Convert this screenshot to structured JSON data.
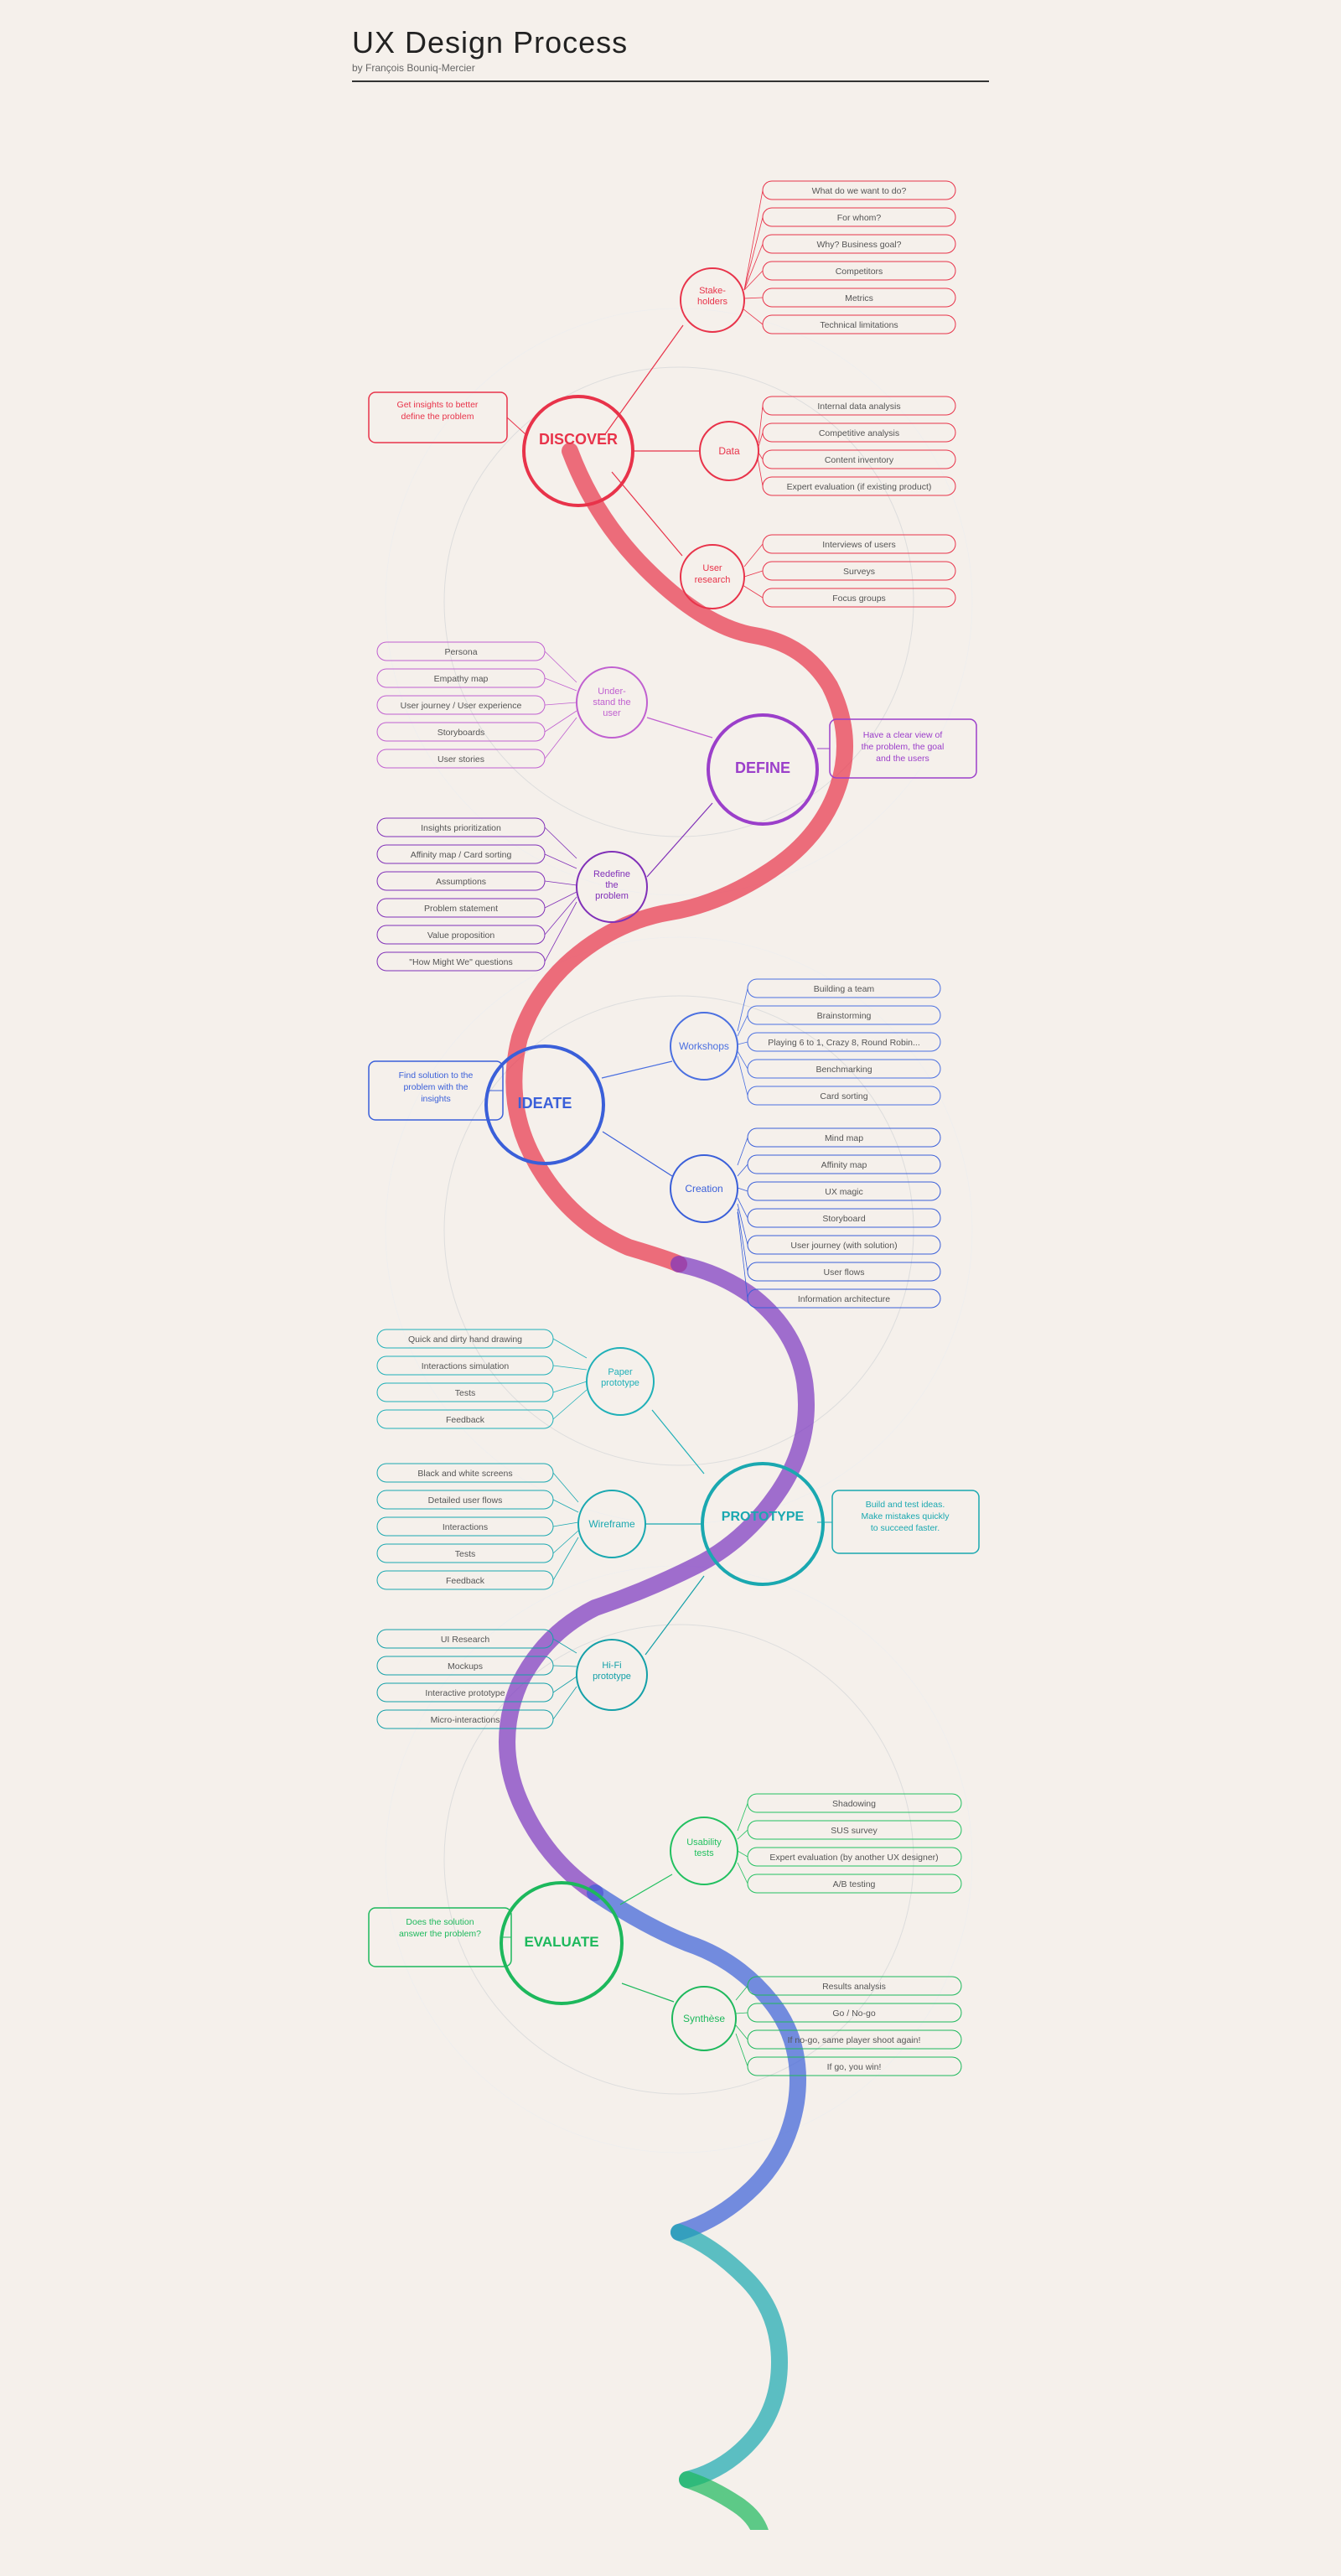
{
  "title": "UX Design Process",
  "subtitle": "by François Bouniq-Mercier",
  "phases": [
    {
      "id": "discover",
      "label": "DISCOVER",
      "color": "#e8334a",
      "note": "Get insights to better\ndefine the problem",
      "sub_nodes": [
        {
          "label": "Stake-\nholders",
          "items": [
            "What do we want to do?",
            "For whom?",
            "Why? Business goal?",
            "Competitors",
            "Metrics",
            "Technical limitations"
          ]
        },
        {
          "label": "Data",
          "items": [
            "Internal data analysis",
            "Competitive analysis",
            "Content inventory",
            "Expert evaluation (if existing product)"
          ]
        },
        {
          "label": "User\nresearch",
          "items": [
            "Interviews of users",
            "Surveys",
            "Focus groups"
          ]
        }
      ]
    },
    {
      "id": "define",
      "label": "DEFINE",
      "color": "#9b3fca",
      "note": "Have a clear view of\nthe problem, the goal\nand the users",
      "sub_nodes": [
        {
          "label": "Under-\nstand the\nuser",
          "items": [
            "Persona",
            "Empathy map",
            "User journey / User experience",
            "Storyboards",
            "User stories"
          ]
        },
        {
          "label": "Redefine\nthe\nproblem",
          "items": [
            "Insights prioritization",
            "Affinity map / Card sorting",
            "Assumptions",
            "Problem statement",
            "Value proposition",
            "\"How Might We\" questions"
          ]
        }
      ]
    },
    {
      "id": "ideate",
      "label": "IDEATE",
      "color": "#3a5fd9",
      "note": "Find solution to the\nproblem with the\ninsights",
      "sub_nodes": [
        {
          "label": "Workshops",
          "items": [
            "Building a team",
            "Brainstorming",
            "Playing 6 to 1, Crazy 8, Round Robin...",
            "Benchmarking",
            "Card sorting"
          ]
        },
        {
          "label": "Creation",
          "items": [
            "Mind map",
            "Affinity map",
            "UX magic",
            "Storyboard",
            "User journey (with solution)",
            "User flows",
            "Information architecture"
          ]
        }
      ]
    },
    {
      "id": "prototype",
      "label": "PROTOTYPE",
      "color": "#1aa8b0",
      "note": "Build and test ideas.\nMake mistakes quickly\nto succeed faster.",
      "sub_nodes": [
        {
          "label": "Paper\nprototype",
          "items": [
            "Quick and dirty hand drawing",
            "Interactions simulation",
            "Tests",
            "Feedback"
          ]
        },
        {
          "label": "Wireframe",
          "items": [
            "Black and white screens",
            "Detailed user flows",
            "Interactions",
            "Tests",
            "Feedback"
          ]
        },
        {
          "label": "Hi-Fi\nprototype",
          "items": [
            "UI Research",
            "Mockups",
            "Interactive prototype",
            "Micro-interactions"
          ]
        }
      ]
    },
    {
      "id": "evaluate",
      "label": "EVALUATE",
      "color": "#1db85c",
      "note": "Does the solution\nanswer the problem?",
      "sub_nodes": [
        {
          "label": "Usability\ntests",
          "items": [
            "Shadowing",
            "SUS survey",
            "Expert evaluation (by another UX designer)",
            "A/B testing"
          ]
        },
        {
          "label": "Synthèse",
          "items": [
            "Results analysis",
            "Go / No-go",
            "If no-go, same player shoot again!",
            "If go, you win!"
          ]
        }
      ]
    }
  ]
}
